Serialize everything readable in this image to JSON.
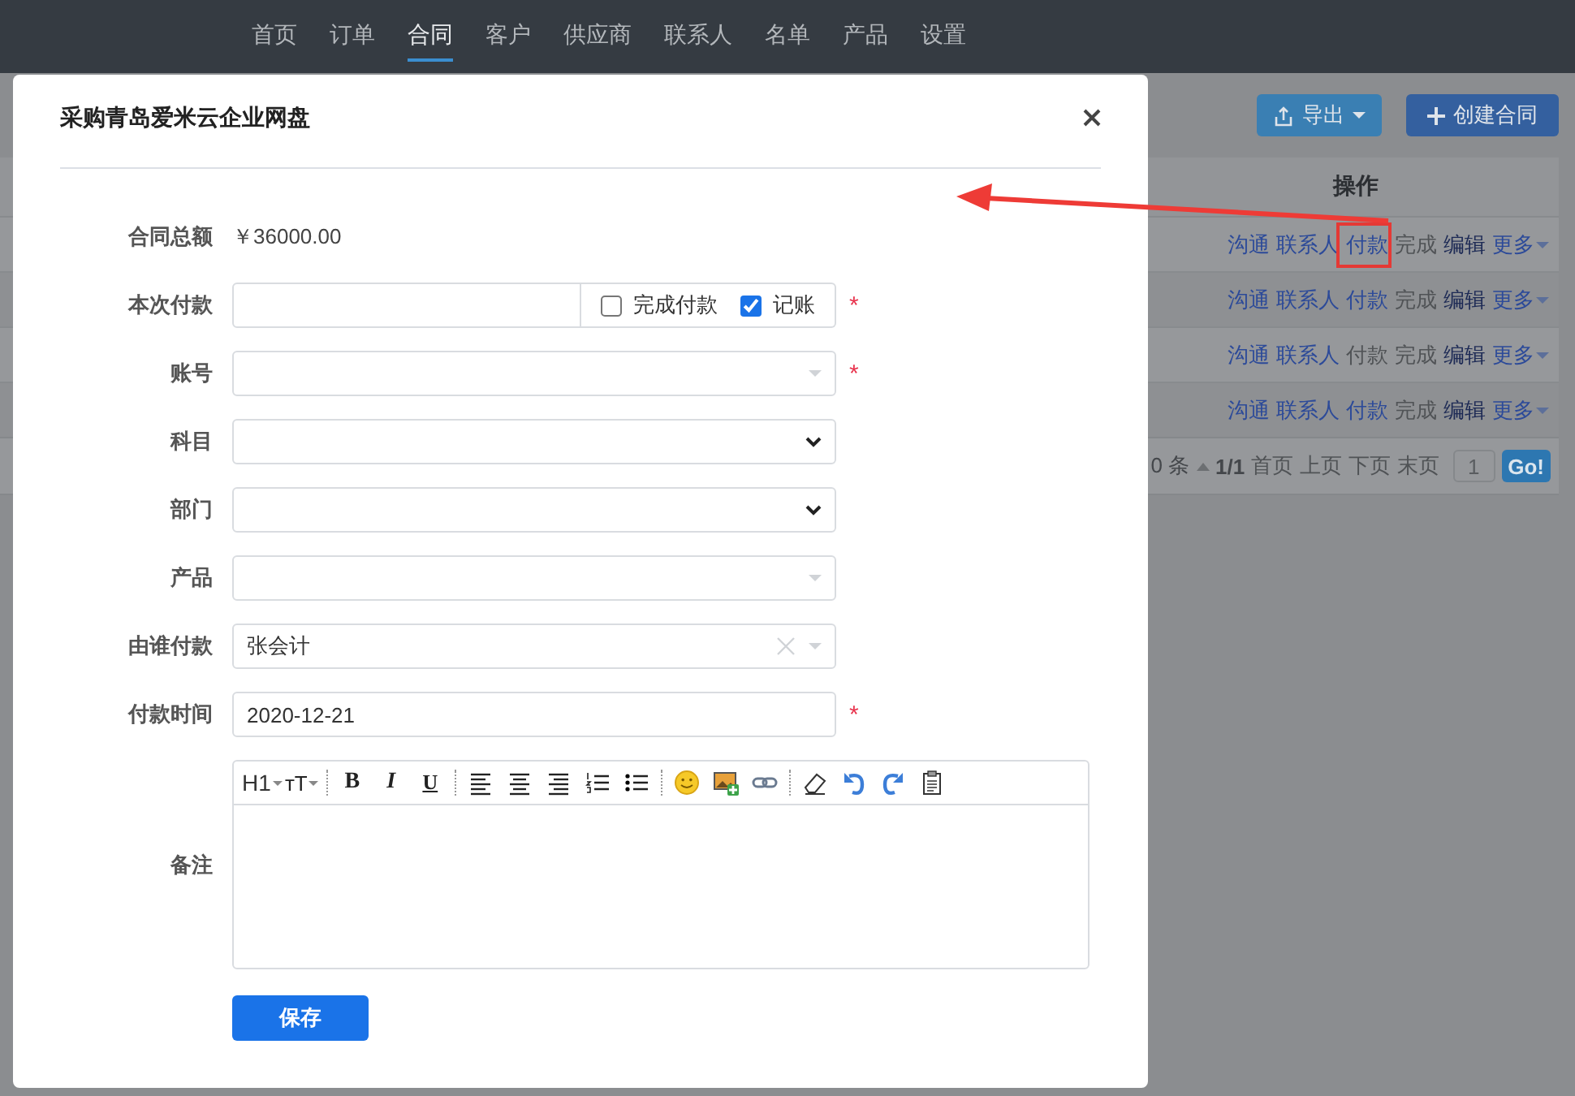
{
  "nav": [
    {
      "label": "首页",
      "selected": false
    },
    {
      "label": "订单",
      "selected": false
    },
    {
      "label": "合同",
      "selected": true
    },
    {
      "label": "客户",
      "selected": false
    },
    {
      "label": "供应商",
      "selected": false
    },
    {
      "label": "联系人",
      "selected": false
    },
    {
      "label": "名单",
      "selected": false
    },
    {
      "label": "产品",
      "selected": false
    },
    {
      "label": "设置",
      "selected": false
    }
  ],
  "toolbar": {
    "export_button": "导出",
    "create_button": "创建合同"
  },
  "table": {
    "columns": [
      "操作"
    ],
    "rows": [
      {
        "actions": [
          {
            "label": "沟通",
            "kind": "link",
            "disabled": false
          },
          {
            "label": "联系人",
            "kind": "link",
            "disabled": false
          },
          {
            "label": "付款",
            "kind": "link",
            "disabled": false
          },
          {
            "label": "完成",
            "kind": "link",
            "disabled": true
          },
          {
            "label": "编辑",
            "kind": "strong",
            "disabled": false
          },
          {
            "label": "更多",
            "kind": "dropdown",
            "disabled": false
          }
        ]
      },
      {
        "actions": [
          {
            "label": "沟通",
            "kind": "link",
            "disabled": false
          },
          {
            "label": "联系人",
            "kind": "link",
            "disabled": false
          },
          {
            "label": "付款",
            "kind": "link",
            "disabled": false
          },
          {
            "label": "完成",
            "kind": "link",
            "disabled": true
          },
          {
            "label": "编辑",
            "kind": "strong",
            "disabled": false
          },
          {
            "label": "更多",
            "kind": "dropdown",
            "disabled": false
          }
        ]
      },
      {
        "actions": [
          {
            "label": "沟通",
            "kind": "link",
            "disabled": false
          },
          {
            "label": "联系人",
            "kind": "link",
            "disabled": false
          },
          {
            "label": "付款",
            "kind": "link",
            "disabled": true
          },
          {
            "label": "完成",
            "kind": "link",
            "disabled": true
          },
          {
            "label": "编辑",
            "kind": "strong",
            "disabled": false
          },
          {
            "label": "更多",
            "kind": "dropdown",
            "disabled": false
          }
        ]
      },
      {
        "actions": [
          {
            "label": "沟通",
            "kind": "link",
            "disabled": false
          },
          {
            "label": "联系人",
            "kind": "link",
            "disabled": false
          },
          {
            "label": "付款",
            "kind": "link",
            "disabled": false
          },
          {
            "label": "完成",
            "kind": "link",
            "disabled": true
          },
          {
            "label": "编辑",
            "kind": "strong",
            "disabled": false
          },
          {
            "label": "更多",
            "kind": "dropdown",
            "disabled": false
          }
        ]
      }
    ]
  },
  "pagination": {
    "total": "0 条",
    "page": "1/1",
    "links": [
      "首页",
      "上页",
      "下页",
      "末页"
    ],
    "page_input": "1",
    "go_button": "Go!"
  },
  "dialog": {
    "title": "采购青岛爱米云企业网盘",
    "fields": [
      {
        "label": "合同总额",
        "kind": "static",
        "value": "￥36000.00"
      },
      {
        "label": "本次付款",
        "kind": "amount",
        "required_mark": "*",
        "options": [
          {
            "label": "完成付款",
            "checked": false
          },
          {
            "label": "记账",
            "checked": true
          }
        ]
      },
      {
        "label": "账号",
        "kind": "combo",
        "required_mark": "*"
      },
      {
        "label": "科目",
        "kind": "select"
      },
      {
        "label": "部门",
        "kind": "select"
      },
      {
        "label": "产品",
        "kind": "combo"
      },
      {
        "label": "由谁付款",
        "kind": "combo",
        "value": "张会计",
        "clearable": true
      },
      {
        "label": "付款时间",
        "kind": "date",
        "value": "2020-12-21",
        "required_mark": "*"
      },
      {
        "label": "备注",
        "kind": "editor",
        "toolbar": {
          "heading": "H1",
          "font_size": "ᴛT",
          "bold": "B",
          "italic": "I",
          "underline": "U"
        }
      }
    ],
    "save_button": "保存"
  }
}
